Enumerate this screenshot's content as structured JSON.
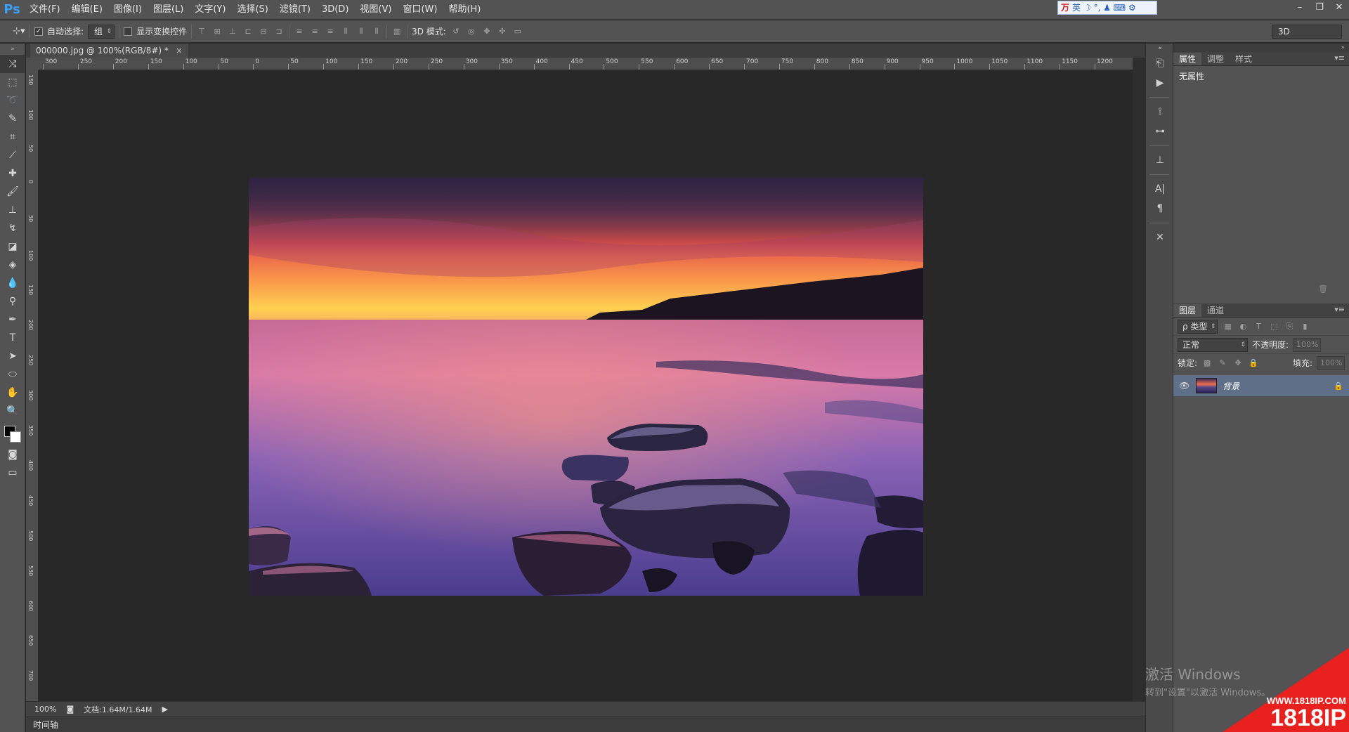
{
  "app": {
    "logo": "Ps"
  },
  "menu": [
    "文件(F)",
    "编辑(E)",
    "图像(I)",
    "图层(L)",
    "文字(Y)",
    "选择(S)",
    "滤镜(T)",
    "3D(D)",
    "视图(V)",
    "窗口(W)",
    "帮助(H)"
  ],
  "ime": {
    "mode": "英",
    "glyphs": "☽ °, ♟ ⌨ ⚙"
  },
  "window_controls": {
    "minimize": "–",
    "restore": "❐",
    "close": "✕"
  },
  "options_bar": {
    "auto_select_label": "自动选择:",
    "auto_select_checked": true,
    "auto_select_value": "组",
    "show_transform_label": "显示变换控件",
    "show_transform_checked": false,
    "mode_3d_label": "3D 模式:",
    "workspace": "3D"
  },
  "document": {
    "tab_title": "000000.jpg @ 100%(RGB/8#) *",
    "close": "×"
  },
  "ruler": {
    "h_labels": [
      "300",
      "250",
      "200",
      "150",
      "100",
      "50",
      "0",
      "50",
      "100",
      "150",
      "200",
      "250",
      "300",
      "350",
      "400",
      "450",
      "500",
      "550",
      "600",
      "650",
      "700",
      "750",
      "800",
      "850",
      "900",
      "950",
      "1000",
      "1050",
      "1100",
      "1150",
      "1200"
    ],
    "v_labels": [
      "150",
      "100",
      "50",
      "0",
      "50",
      "100",
      "150",
      "200",
      "250",
      "300",
      "350",
      "400",
      "450",
      "500",
      "550",
      "600",
      "650",
      "700",
      "750"
    ]
  },
  "status": {
    "zoom": "100%",
    "doc_info": "文档:1.64M/1.64M"
  },
  "timeline_label": "时间轴",
  "properties_panel": {
    "tabs": [
      "属性",
      "调整",
      "样式"
    ],
    "active_tab": 0,
    "body_text": "无属性"
  },
  "layers_panel": {
    "tabs": [
      "图层",
      "通道"
    ],
    "active_tab": 0,
    "filter_kind": "ρ 类型",
    "blend_mode": "正常",
    "opacity_label": "不透明度:",
    "opacity_value": "100%",
    "lock_label": "锁定:",
    "fill_label": "填充:",
    "fill_value": "100%",
    "layers": [
      {
        "name": "背景",
        "visible": true,
        "locked": true
      }
    ]
  },
  "watermark": {
    "title": "激活 Windows",
    "subtitle": "转到\"设置\"以激活 Windows。"
  },
  "logo_stamp": {
    "url": "WWW.1818IP.COM",
    "text": "1818IP",
    "color": "#e8201e"
  },
  "colors": {
    "foreground": "#000000",
    "background": "#ffffff",
    "selected_layer": "#5f6f88"
  }
}
